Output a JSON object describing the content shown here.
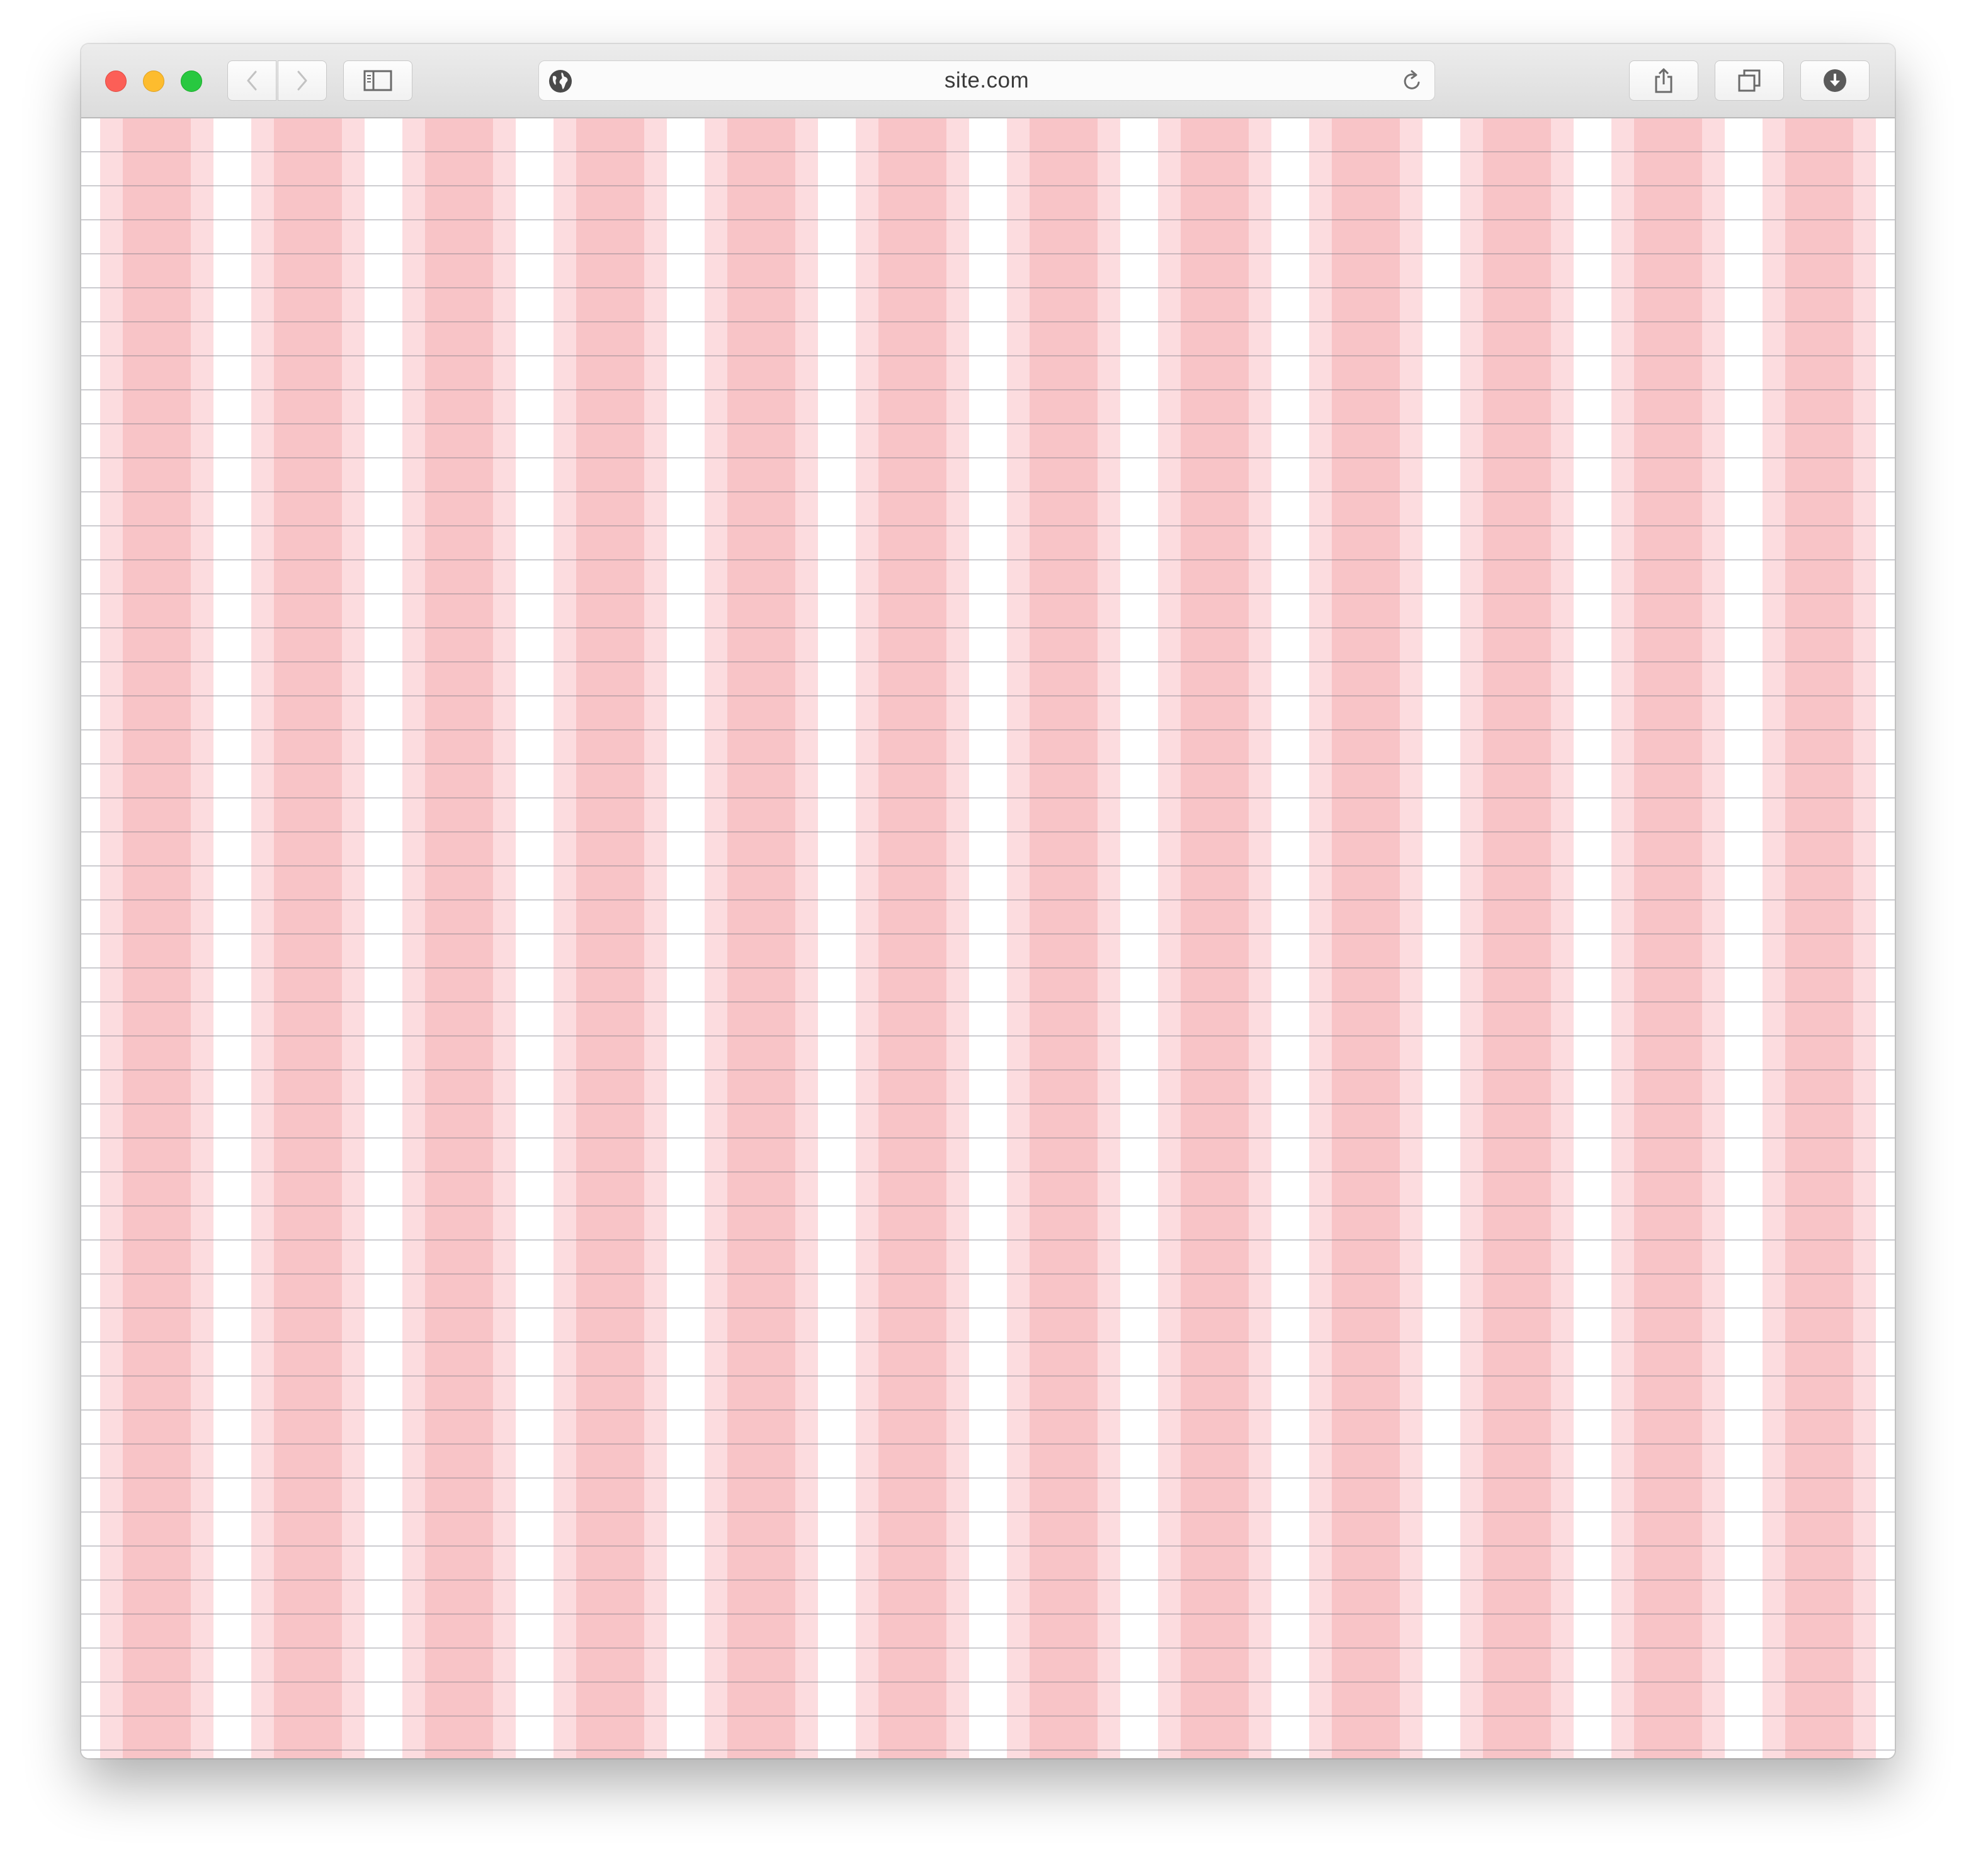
{
  "browser": {
    "address_bar": {
      "url": "site.com"
    },
    "toolbar": {
      "buttons": [
        {
          "name": "back",
          "icon": "chevron-left-icon",
          "enabled": false
        },
        {
          "name": "forward",
          "icon": "chevron-right-icon",
          "enabled": false
        },
        {
          "name": "sidebar",
          "icon": "sidebar-icon"
        },
        {
          "name": "share",
          "icon": "share-icon"
        },
        {
          "name": "tabs",
          "icon": "tabs-overview-icon"
        },
        {
          "name": "downloads",
          "icon": "download-icon"
        }
      ]
    },
    "traffic_lights": {
      "close": "#fc5f57",
      "minimize": "#fdbc2e",
      "maximize": "#28c840"
    }
  },
  "page": {
    "grid_overlay": {
      "column_count": 12,
      "column_color": "#f8c4c7",
      "column_padding_color": "#fcdcdf",
      "gutter_color": "#ffffff",
      "baseline_line_color": "#78788a"
    }
  }
}
